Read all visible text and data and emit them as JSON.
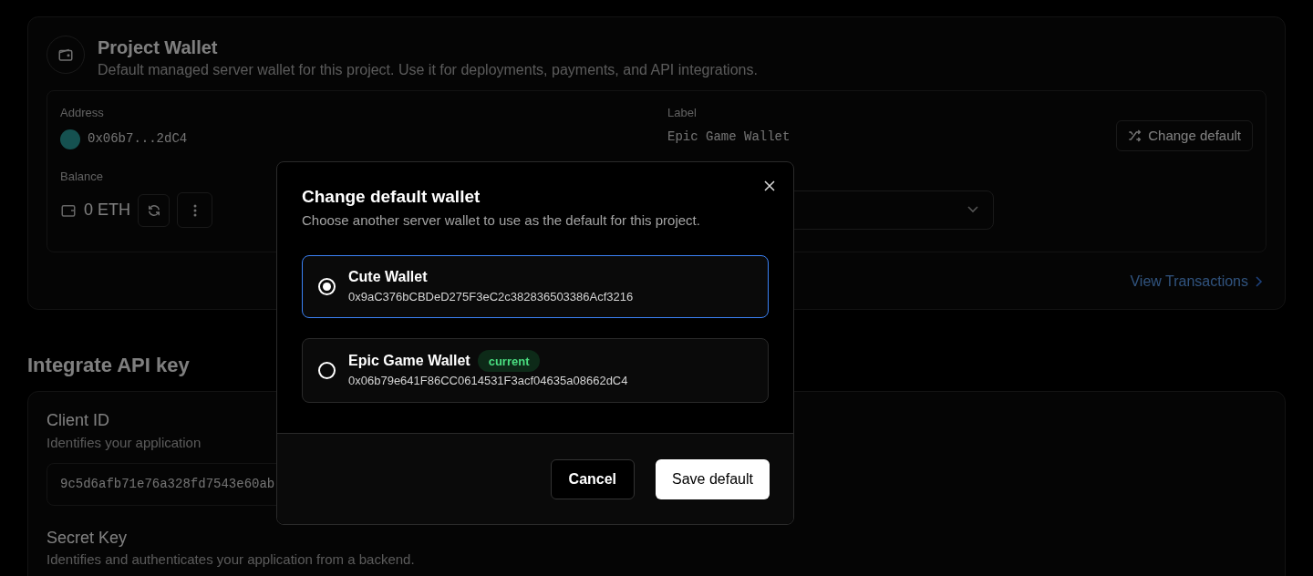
{
  "project_wallet": {
    "title": "Project Wallet",
    "description": "Default managed server wallet for this project. Use it for deployments, payments, and API integrations.",
    "address_label": "Address",
    "address": "0x06b7...2dC4",
    "label_label": "Label",
    "label_value": "Epic Game Wallet",
    "change_button": "Change default",
    "balance_label": "Balance",
    "balance": "0 ETH",
    "view_link": "View Transactions"
  },
  "api_key": {
    "heading": "Integrate API key",
    "client_id_title": "Client ID",
    "client_id_description": "Identifies your application",
    "client_id_value": "9c5d6afb71e76a328fd7543e60ab",
    "secret_title": "Secret Key",
    "secret_description": "Identifies and authenticates your application from a backend."
  },
  "dialog": {
    "title": "Change default wallet",
    "description": "Choose another server wallet to use as the default for this project.",
    "wallets": [
      {
        "name": "Cute Wallet",
        "address": "0x9aC376bCBDeD275F3eC2c382836503386Acf3216",
        "selected": true
      },
      {
        "name": "Epic Game Wallet",
        "address": "0x06b79e641F86CC0614531F3acf04635a08662dC4",
        "selected": false,
        "badge": "current"
      }
    ],
    "cancel": "Cancel",
    "save": "Save default"
  }
}
